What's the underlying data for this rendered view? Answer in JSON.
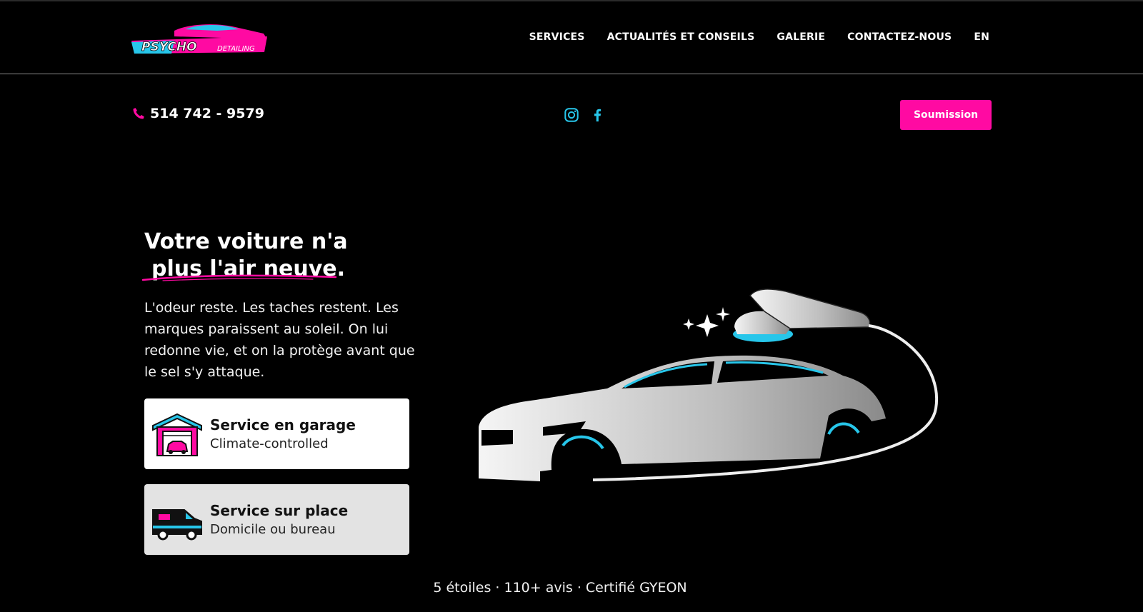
{
  "header": {
    "logo_text": "PSYCHO DETAILING",
    "nav": [
      "SERVICES",
      "ACTUALITÉS ET CONSEILS",
      "GALERIE",
      "CONTACTEZ-NOUS",
      "EN"
    ]
  },
  "contact": {
    "phone": "514 742 - 9579",
    "icons": [
      "phone-icon",
      "instagram-icon",
      "facebook-icon"
    ],
    "cta_label": "Soumission"
  },
  "hero": {
    "line1": "Votre voiture n'a",
    "line2": "plus l'air neuve.",
    "description": "L'odeur reste. Les taches restent. Les marques paraissent au soleil. On lui redonne vie, et on la protège avant que le sel s'y attaque."
  },
  "cards": [
    {
      "title": "Service en garage",
      "subtitle": "Climate-controlled",
      "icon": "garage-icon"
    },
    {
      "title": "Service sur place",
      "subtitle": "Domicile ou bureau",
      "icon": "van-icon"
    }
  ],
  "trust_line": "5 étoiles · 110+ avis · Certifié GYEON",
  "colors": {
    "accent_pink": "#ff0aa2",
    "accent_cyan": "#27c6ea",
    "background": "#000000"
  }
}
